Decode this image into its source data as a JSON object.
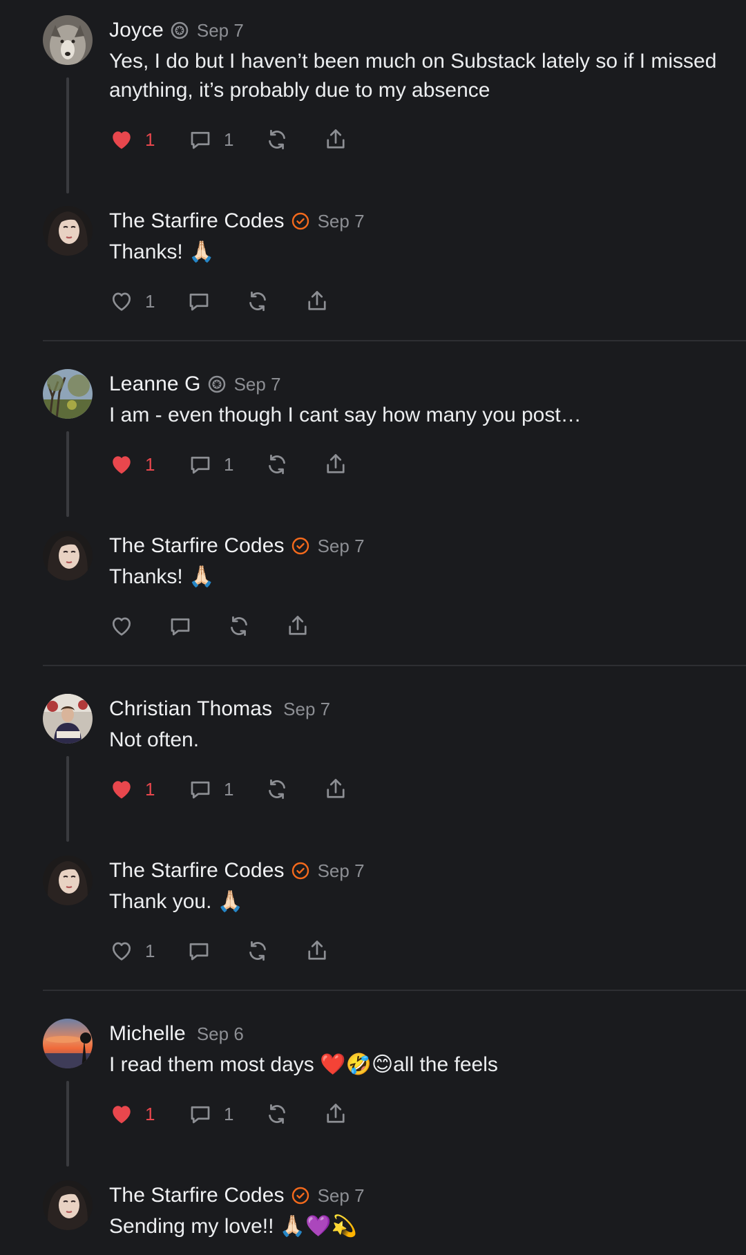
{
  "colors": {
    "background": "#1a1b1e",
    "text": "#eceef0",
    "muted": "#8d8f94",
    "like_active": "#e8474d",
    "verified_badge": "#f46a1c",
    "subscriber_badge": "#8d8f94"
  },
  "comments": [
    {
      "name": "Joyce",
      "badge": "subscriber-icon",
      "date": "Sep 7",
      "text": "Yes, I do but I haven’t been much on Substack lately so if I missed anything, it’s probably due to my absence",
      "likes": "1",
      "liked": true,
      "replies": "1",
      "avatar": "wolf-photo"
    },
    {
      "name": "The Starfire Codes",
      "badge": "verified-icon",
      "date": "Sep 7",
      "text": "Thanks! 🙏🏻",
      "likes": "1",
      "liked": false,
      "replies": "",
      "avatar": "woman-photo"
    },
    {
      "name": "Leanne G",
      "badge": "subscriber-icon",
      "date": "Sep 7",
      "text": "I am - even though I cant say how many you post…",
      "likes": "1",
      "liked": true,
      "replies": "1",
      "avatar": "tree-photo"
    },
    {
      "name": "The Starfire Codes",
      "badge": "verified-icon",
      "date": "Sep 7",
      "text": "Thanks! 🙏🏻",
      "likes": "",
      "liked": false,
      "replies": "",
      "avatar": "woman-photo"
    },
    {
      "name": "Christian Thomas",
      "badge": "",
      "date": "Sep 7",
      "text": "Not often.",
      "likes": "1",
      "liked": true,
      "replies": "1",
      "avatar": "man-photo"
    },
    {
      "name": "The Starfire Codes",
      "badge": "verified-icon",
      "date": "Sep 7",
      "text": "Thank you. 🙏🏻",
      "likes": "1",
      "liked": false,
      "replies": "",
      "avatar": "woman-photo"
    },
    {
      "name": "Michelle",
      "badge": "",
      "date": "Sep 6",
      "text": "I read them most days ❤️🤣😊all the feels",
      "likes": "1",
      "liked": true,
      "replies": "1",
      "avatar": "sunset-photo"
    },
    {
      "name": "The Starfire Codes",
      "badge": "verified-icon",
      "date": "Sep 7",
      "text": "Sending my love!! 🙏🏻💜💫",
      "likes": "",
      "liked": false,
      "replies": "",
      "avatar": "woman-photo"
    }
  ]
}
